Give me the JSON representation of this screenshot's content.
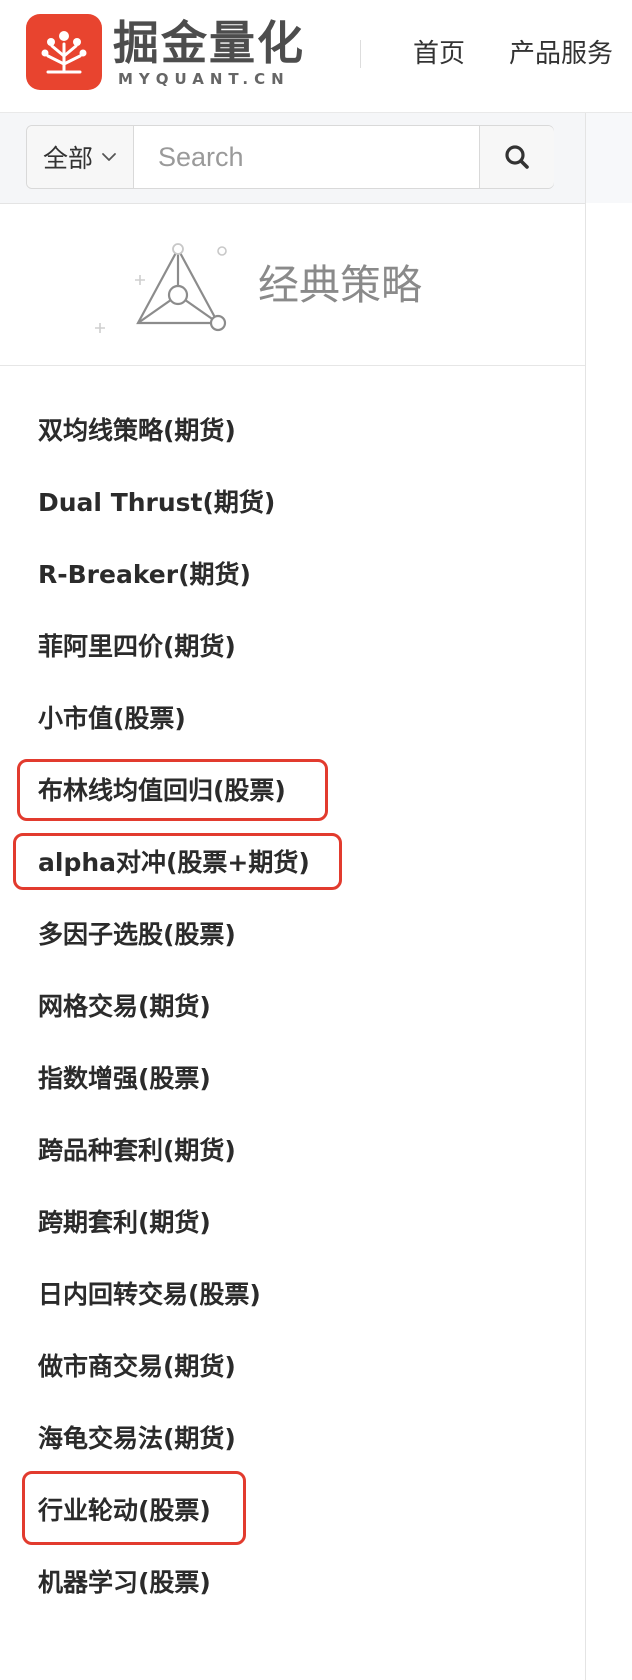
{
  "header": {
    "brand_name": "掘金量化",
    "brand_sub": "MYQUANT.CN",
    "nav": [
      {
        "label": "首页"
      },
      {
        "label": "产品服务"
      }
    ]
  },
  "search": {
    "scope_label": "全部",
    "placeholder": "Search"
  },
  "section": {
    "title": "经典策略"
  },
  "strategies": [
    {
      "label": "双均线策略(期货)",
      "highlighted": false
    },
    {
      "label": "Dual Thrust(期货)",
      "highlighted": false
    },
    {
      "label": "R-Breaker(期货)",
      "highlighted": false
    },
    {
      "label": "菲阿里四价(期货)",
      "highlighted": false
    },
    {
      "label": "小市值(股票)",
      "highlighted": false
    },
    {
      "label": "布林线均值回归(股票)",
      "highlighted": true
    },
    {
      "label": "alpha对冲(股票+期货)",
      "highlighted": true
    },
    {
      "label": "多因子选股(股票)",
      "highlighted": false
    },
    {
      "label": "网格交易(期货)",
      "highlighted": false
    },
    {
      "label": "指数增强(股票)",
      "highlighted": false
    },
    {
      "label": "跨品种套利(期货)",
      "highlighted": false
    },
    {
      "label": "跨期套利(期货)",
      "highlighted": false
    },
    {
      "label": "日内回转交易(股票)",
      "highlighted": false
    },
    {
      "label": "做市商交易(期货)",
      "highlighted": false
    },
    {
      "label": "海龟交易法(期货)",
      "highlighted": false
    },
    {
      "label": "行业轮动(股票)",
      "highlighted": true
    },
    {
      "label": "机器学习(股票)",
      "highlighted": false
    }
  ],
  "colors": {
    "brand": "#e8442f",
    "highlight": "#e23b2e"
  }
}
